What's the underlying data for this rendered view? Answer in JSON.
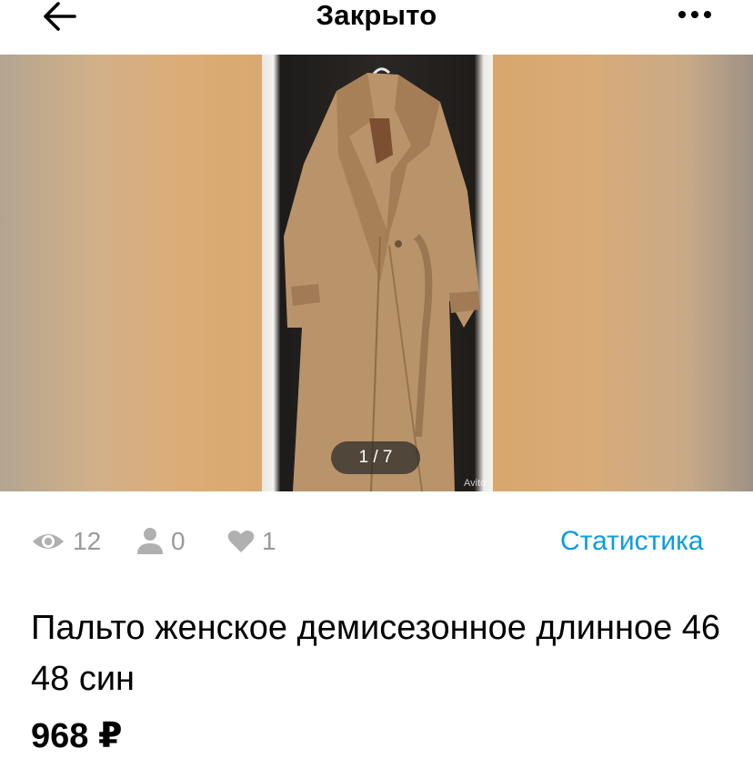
{
  "header": {
    "title": "Закрыто",
    "back_icon": "arrow-left-icon",
    "more_icon": "more-dots-icon"
  },
  "gallery": {
    "counter": "1 / 7",
    "watermark": "Avito"
  },
  "stats": {
    "views": "12",
    "contacts": "0",
    "favorites": "1",
    "link_label": "Статистика",
    "icon_color": "#9a9a9a",
    "link_color": "#0a9ce0"
  },
  "listing": {
    "title": "Пальто женское демисезонное длинное 46 48 син",
    "price": "968 ₽"
  }
}
